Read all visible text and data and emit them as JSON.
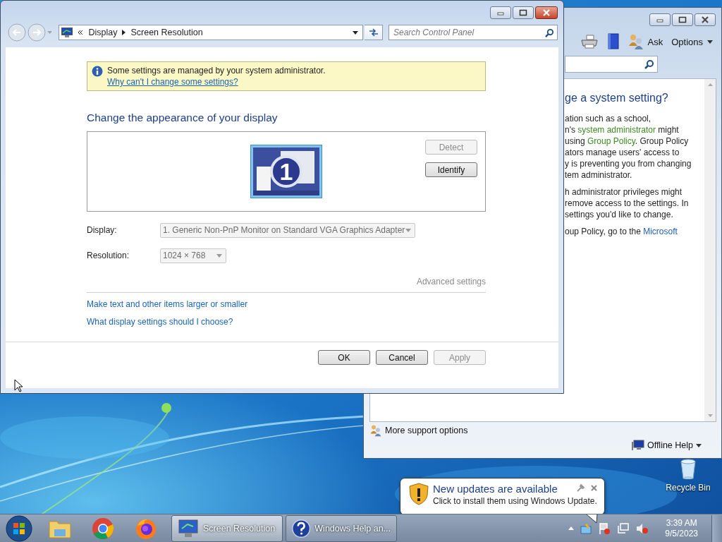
{
  "main_window": {
    "breadcrumb": [
      "Display",
      "Screen Resolution"
    ],
    "search": {
      "placeholder": "Search Control Panel"
    },
    "notice": {
      "text": "Some settings are managed by your system administrator.",
      "link": "Why can't I change some settings?"
    },
    "heading": "Change the appearance of your display",
    "monitor": {
      "number": "1"
    },
    "detect_button": {
      "label": "Detect",
      "disabled": true
    },
    "identify_button": {
      "label": "Identify",
      "disabled": false
    },
    "fields": [
      {
        "label": "Display:",
        "value": "1. Generic Non-PnP Monitor on Standard VGA Graphics Adapter",
        "disabled": true
      },
      {
        "label": "Resolution:",
        "value": "1024 × 768",
        "disabled": true
      }
    ],
    "advanced_link": {
      "label": "Advanced settings",
      "disabled": true
    },
    "links": [
      "Make text and other items larger or smaller",
      "What display settings should I choose?"
    ],
    "buttons": [
      {
        "label": "OK",
        "disabled": false
      },
      {
        "label": "Cancel",
        "disabled": false
      },
      {
        "label": "Apply",
        "disabled": true
      }
    ]
  },
  "help_window": {
    "toolbar": [
      {
        "kind": "print"
      },
      {
        "kind": "browse"
      },
      {
        "kind": "ask",
        "label": "Ask"
      },
      {
        "kind": "options",
        "label": "Options"
      }
    ],
    "heading": "ge a system setting?",
    "paragraphs": [
      [
        [
          "ation such as a school,"
        ],
        [
          "n's ",
          {
            "text": "system administrator",
            "kind": "term"
          },
          " might"
        ],
        [
          "using ",
          {
            "text": "Group Policy",
            "kind": "term"
          },
          ". Group Policy"
        ],
        [
          "ators manage users' access to"
        ],
        [
          "y is preventing you from changing"
        ],
        [
          "tem administrator."
        ]
      ],
      [
        [
          "h administrator privileges might"
        ],
        [
          "remove access to the settings. In"
        ],
        [
          "settings you'd like to change."
        ]
      ],
      [
        [
          "oup Policy, go to the ",
          {
            "text": "Microsoft",
            "kind": "link"
          }
        ]
      ]
    ],
    "support": "More support options",
    "offline": "Offline Help"
  },
  "desktop_icons": [
    {
      "label": "Recycle Bin"
    }
  ],
  "notification": {
    "title": "New updates are available",
    "message": "Click to install them using Windows Update."
  },
  "taskbar": {
    "pinned": [
      {
        "kind": "folder"
      },
      {
        "kind": "round-browser"
      },
      {
        "kind": "fox-browser"
      }
    ],
    "tasks": [
      {
        "label": "Screen Resolution",
        "kind": "display",
        "selected": true
      },
      {
        "label": "Windows Help an...",
        "kind": "help",
        "selected": false
      }
    ],
    "clock": {
      "time": "3:39 AM",
      "date": "9/5/2023"
    }
  }
}
